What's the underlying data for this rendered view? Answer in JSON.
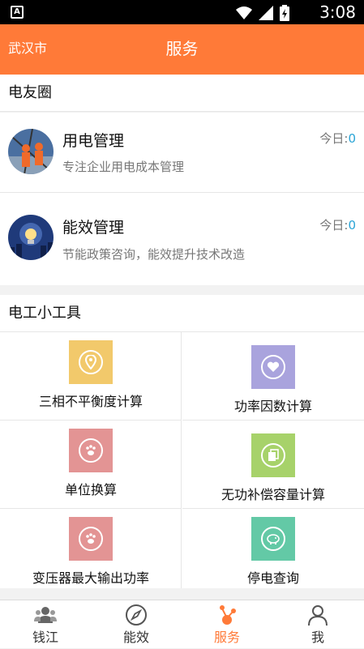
{
  "status_bar": {
    "app_badge": "A",
    "time": "3:08"
  },
  "header": {
    "city": "武汉市",
    "title": "服务"
  },
  "circle_section": {
    "title": "电友圈",
    "items": [
      {
        "name": "用电管理",
        "desc": "专注企业用电成本管理",
        "today_label": "今日:",
        "today_count": "0"
      },
      {
        "name": "能效管理",
        "desc": "节能政策咨询，能效提升技术改造",
        "today_label": "今日:",
        "today_count": "0"
      }
    ]
  },
  "tools_section": {
    "title": "电工小工具",
    "tools": [
      {
        "label": "三相不平衡度计算",
        "color": "#f2c96b",
        "icon": "location-pin-icon"
      },
      {
        "label": "功率因数计算",
        "color": "#a9a3dd",
        "icon": "heart-icon"
      },
      {
        "label": "单位换算",
        "color": "#e39494",
        "icon": "paw-icon"
      },
      {
        "label": "无功补偿容量计算",
        "color": "#a7d26a",
        "icon": "document-icon"
      },
      {
        "label": "变压器最大输出功率",
        "color": "#e39494",
        "icon": "paw-icon"
      },
      {
        "label": "停电查询",
        "color": "#63c9a6",
        "icon": "piggy-bank-icon"
      }
    ]
  },
  "tabbar": {
    "tabs": [
      {
        "label": "钱江",
        "active": false
      },
      {
        "label": "能效",
        "active": false
      },
      {
        "label": "服务",
        "active": true
      },
      {
        "label": "我",
        "active": false
      }
    ],
    "active_color": "#ff7a38"
  },
  "colors": {
    "brand": "#ff7a38",
    "count": "#2aa4d6"
  }
}
